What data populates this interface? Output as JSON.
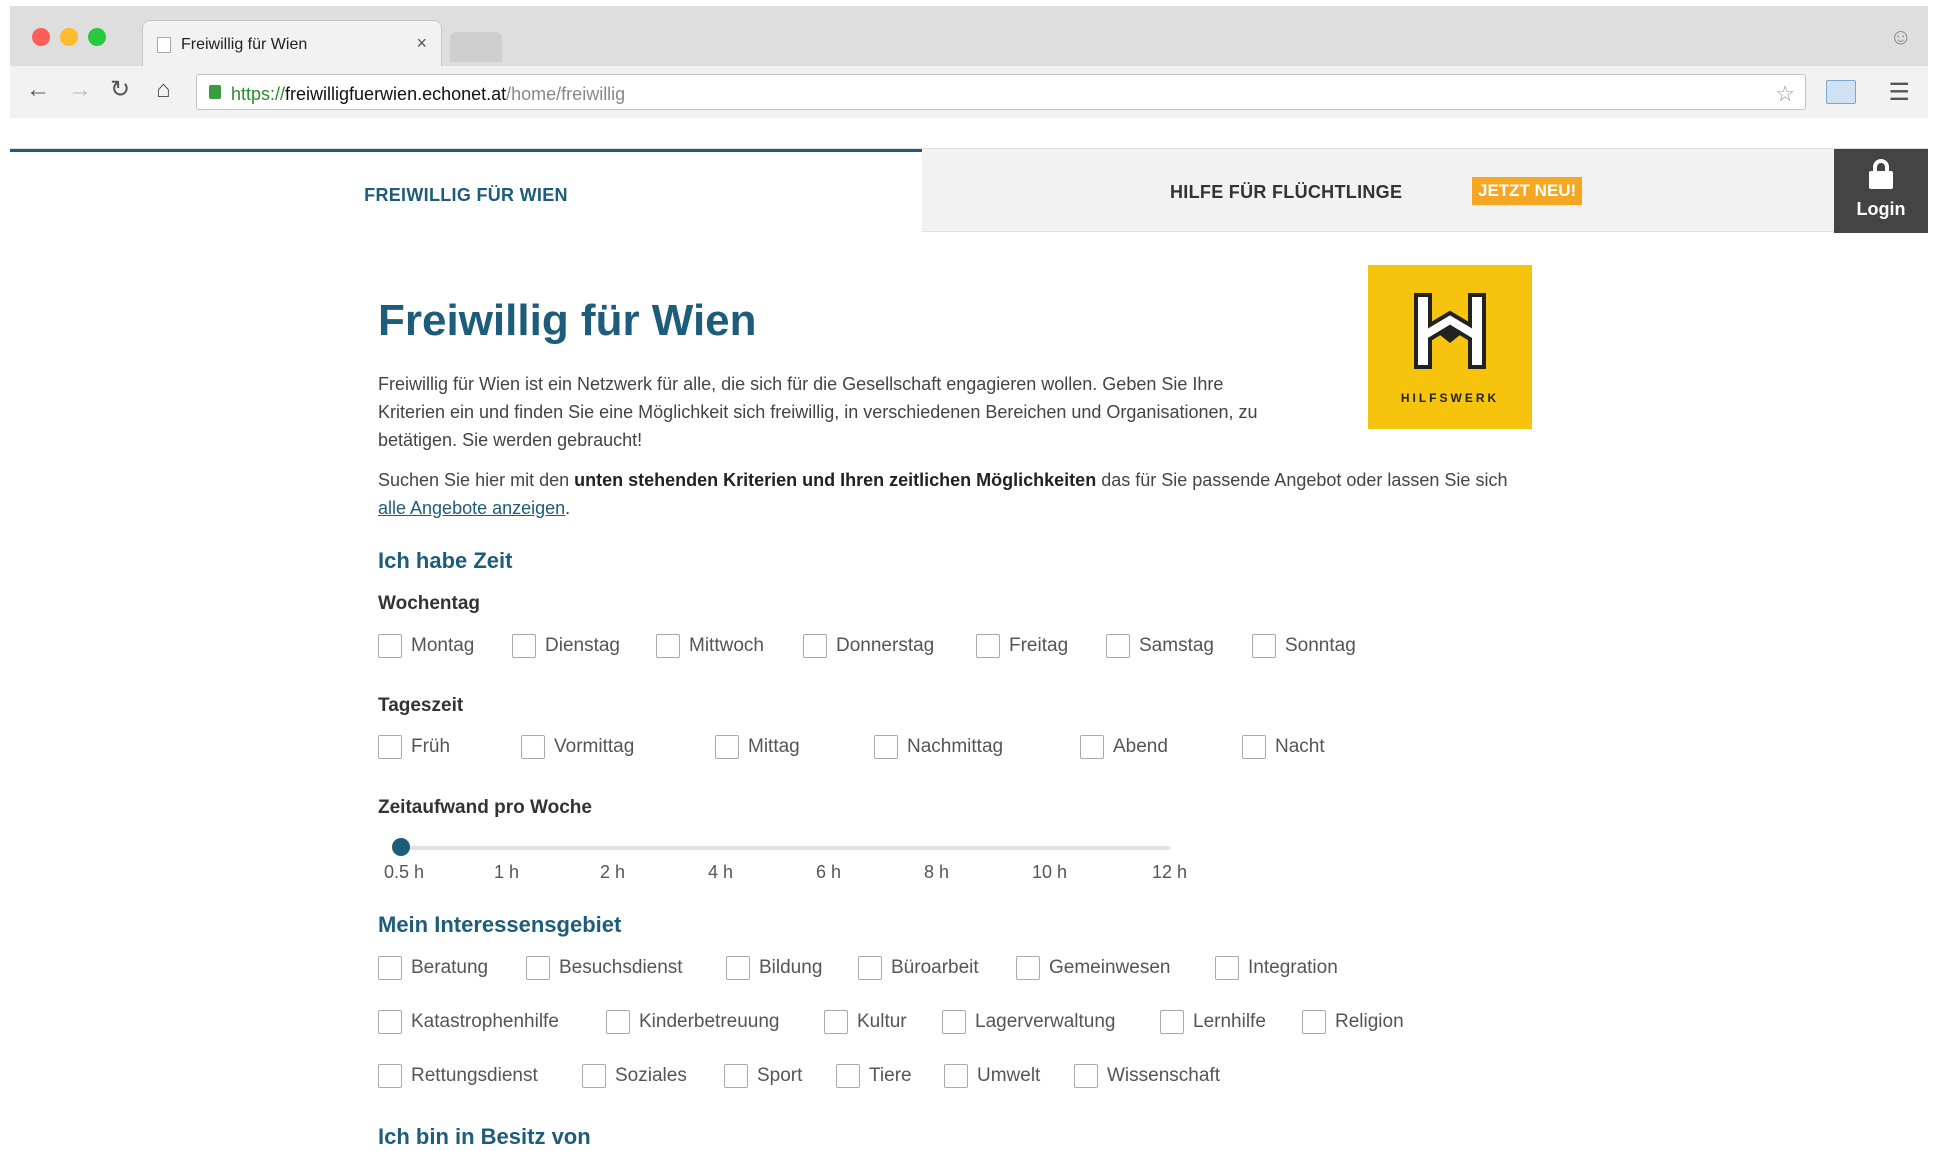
{
  "browser": {
    "tab_title": "Freiwillig für Wien",
    "tab_close": "×",
    "url_scheme": "https://",
    "url_host": "freiwilligfuerwien.echonet.at",
    "url_path": "/home/freiwillig"
  },
  "nav": {
    "active_label": "FREIWILLIG FÜR WIEN",
    "refugee_label": "HILFE FÜR FLÜCHTLINGE",
    "badge": "JETZT NEU!",
    "login_label": "Login"
  },
  "main": {
    "title": "Freiwillig für Wien",
    "intro": "Freiwillig für Wien ist ein Netzwerk für alle, die sich für die Gesellschaft engagieren wollen. Geben Sie Ihre Kriterien ein und finden Sie eine Möglichkeit sich freiwillig, in verschiedenen Bereichen und Organisationen, zu betätigen. Sie werden gebraucht!",
    "search_pre": "Suchen Sie hier mit den ",
    "search_bold": "unten stehenden Kriterien und Ihren zeitlichen Möglichkeiten",
    "search_mid": " das für Sie passende Angebot oder lassen Sie sich ",
    "search_link": "alle Angebote anzeigen",
    "search_post": ".",
    "logo_text": "HILFSWERK"
  },
  "time": {
    "heading": "Ich habe Zeit",
    "weekday_label": "Wochentag",
    "weekdays": [
      "Montag",
      "Dienstag",
      "Mittwoch",
      "Donnerstag",
      "Freitag",
      "Samstag",
      "Sonntag"
    ],
    "daytime_label": "Tageszeit",
    "daytimes": [
      "Früh",
      "Vormittag",
      "Mittag",
      "Nachmittag",
      "Abend",
      "Nacht"
    ],
    "effort_label": "Zeitaufwand pro Woche",
    "slider_ticks": [
      "0.5 h",
      "1 h",
      "2 h",
      "4 h",
      "6 h",
      "8 h",
      "10 h",
      "12 h"
    ],
    "slider_value": "0.5 h"
  },
  "interests": {
    "heading": "Mein Interessensgebiet",
    "row1": [
      "Beratung",
      "Besuchsdienst",
      "Bildung",
      "Büroarbeit",
      "Gemeinwesen",
      "Integration"
    ],
    "row2": [
      "Katastrophenhilfe",
      "Kinderbetreuung",
      "Kultur",
      "Lagerverwaltung",
      "Lernhilfe",
      "Religion"
    ],
    "row3": [
      "Rettungsdienst",
      "Soziales",
      "Sport",
      "Tiere",
      "Umwelt",
      "Wissenschaft"
    ]
  },
  "possession": {
    "heading": "Ich bin in Besitz von"
  },
  "colors": {
    "primary": "#1d5c7a",
    "badge": "#f5a623",
    "logo": "#f6c40d"
  },
  "icons": {
    "back": "arrow-left-icon",
    "forward": "arrow-right-icon",
    "reload": "reload-icon",
    "home": "home-icon",
    "lock": "lock-icon",
    "star": "star-icon",
    "menu": "hamburger-menu-icon",
    "login": "padlock-icon"
  }
}
